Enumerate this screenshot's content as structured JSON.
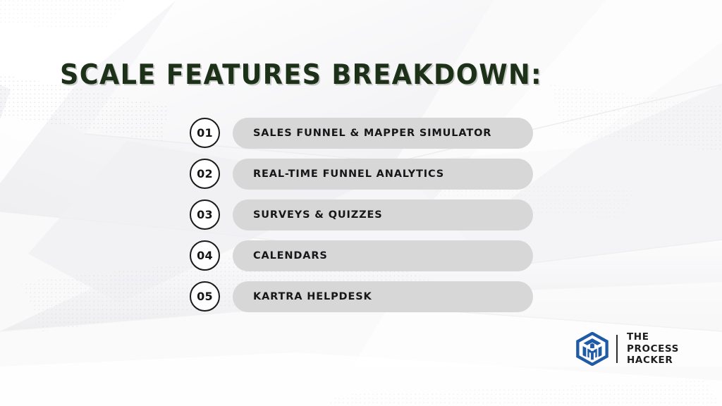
{
  "slide": {
    "title": "SCALE FEATURES BREAKDOWN:",
    "background_color": "#f7f7f8",
    "title_color": "#1c3118",
    "pill_color": "#d7d7d7",
    "accent_logo_color": "#1f5aa6"
  },
  "features": [
    {
      "number": "01",
      "label": "SALES FUNNEL & MAPPER SIMULATOR"
    },
    {
      "number": "02",
      "label": "REAL-TIME FUNNEL ANALYTICS"
    },
    {
      "number": "03",
      "label": "SURVEYS & QUIZZES"
    },
    {
      "number": "04",
      "label": "CALENDARS"
    },
    {
      "number": "05",
      "label": "KARTRA HELPDESK"
    }
  ],
  "logo": {
    "mark_name": "isometric-cube-icon",
    "line1": "THE",
    "line2": "PROCESS",
    "line3": "HACKER"
  }
}
